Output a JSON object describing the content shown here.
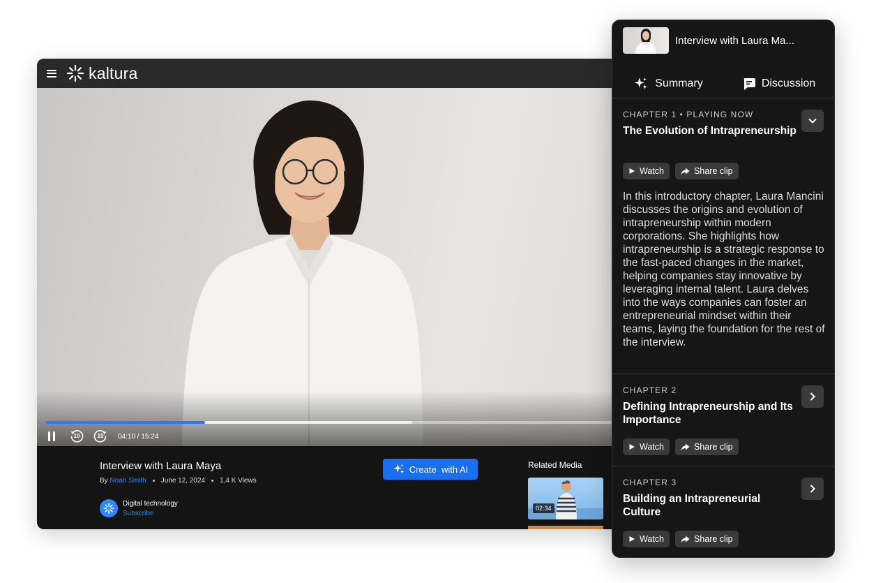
{
  "brand": {
    "name": "kaltura",
    "accent": "#1a6ef0"
  },
  "player": {
    "timecode": "04:10 / 15:24",
    "played_fraction": 0.27,
    "buffered_fraction": 0.62,
    "skip_back_seconds": "10",
    "skip_forward_seconds": "10"
  },
  "video_info": {
    "title": "Interview with Laura Maya",
    "by_prefix": "By",
    "author": "Noah Smith",
    "date": "June 12, 2024",
    "views": "1,4 K Views",
    "channel_name": "Digital technology",
    "subscribe_label": "Subscribe",
    "create_ai_label": "Create  with AI"
  },
  "related": {
    "label": "Related Media",
    "items": [
      {
        "duration": "02:34"
      }
    ]
  },
  "panel": {
    "title": "Interview with Laura Ma...",
    "tabs": [
      {
        "label": "Summary"
      },
      {
        "label": "Discussion"
      }
    ],
    "watch_label": "Watch",
    "share_label": "Share clip",
    "chapters": [
      {
        "label": "CHAPTER 1  •  PLAYING NOW",
        "title": "The Evolution of Intrapreneurship",
        "expanded": true,
        "body": "In this introductory chapter, Laura Mancini discusses the origins and evolution of intrapreneurship within modern corporations. She highlights how intrapreneurship is a strategic response to the fast-paced changes in the market, helping companies stay innovative by leveraging internal talent. Laura delves into the ways companies can foster an entrepreneurial mindset within their teams, laying the foundation for the rest of the interview."
      },
      {
        "label": "CHAPTER 2",
        "title": "Defining Intrapreneurship and Its Importance",
        "expanded": false
      },
      {
        "label": "CHAPTER 3",
        "title": "Building an Intrapreneurial Culture",
        "expanded": false
      }
    ]
  }
}
